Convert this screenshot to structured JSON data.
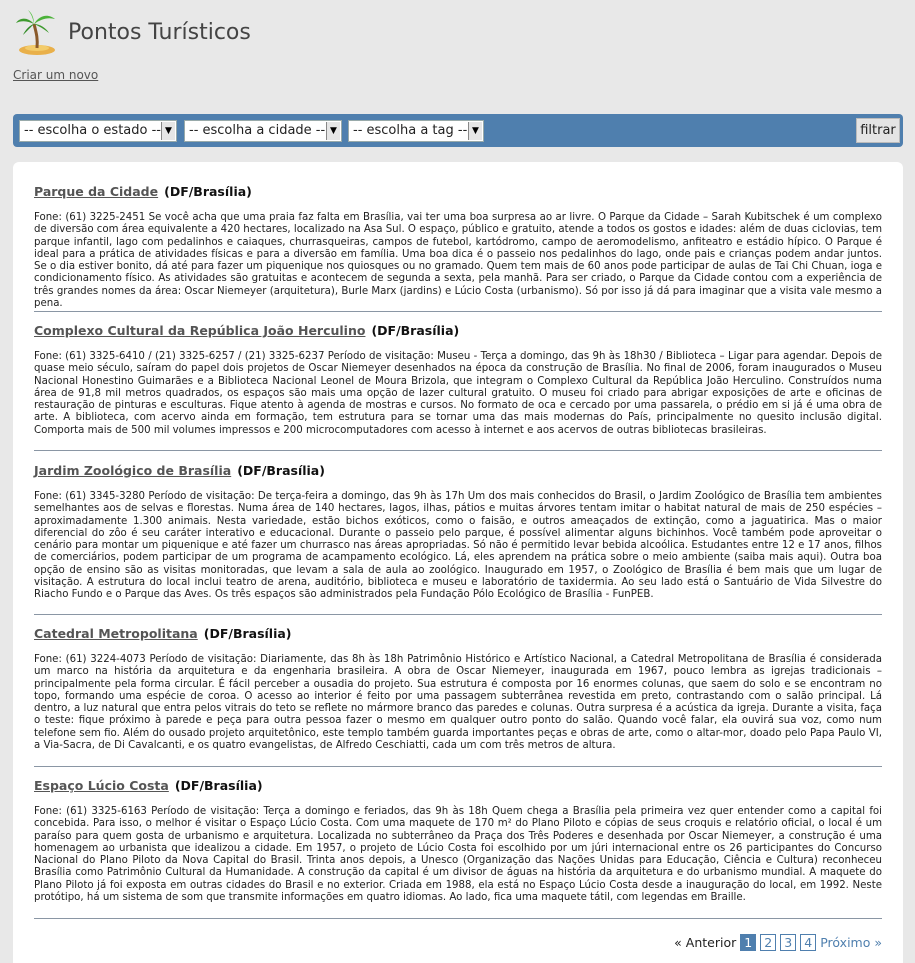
{
  "header": {
    "title": "Pontos Turísticos",
    "create_link": "Criar um novo"
  },
  "filters": {
    "state": "-- escolha o estado --",
    "city": "-- escolha a cidade --",
    "tag": "-- escolha a tag --",
    "button": "filtrar"
  },
  "entries": [
    {
      "name": "Parque da Cidade",
      "location": "(DF/Brasília)",
      "description": "Fone: (61) 3225-2451 Se você acha que uma praia faz falta em Brasília, vai ter uma boa surpresa ao ar livre. O Parque da Cidade – Sarah Kubitschek é um complexo de diversão com área equivalente a 420 hectares, localizado na Asa Sul. O espaço, público e gratuito, atende a todos os gostos e idades: além de duas ciclovias, tem parque infantil, lago com pedalinhos e caiaques, churrasqueiras, campos de futebol, kartódromo, campo de aeromodelismo, anfiteatro e estádio hípico. O Parque é ideal para a prática de atividades físicas e para a diversão em família. Uma boa dica é o passeio nos pedalinhos do lago, onde pais e crianças podem andar juntos. Se o dia estiver bonito, dá até para fazer um piquenique nos quiosques ou no gramado. Quem tem mais de 60 anos pode participar de aulas de Tai Chi Chuan, ioga e condicionamento físico. As atividades são gratuitas e acontecem de segunda a sexta, pela manhã. Para ser criado, o Parque da Cidade contou com a experiência de três grandes nomes da área: Oscar Niemeyer (arquitetura), Burle Marx (jardins) e Lúcio Costa (urbanismo). Só por isso já dá para imaginar que a visita vale mesmo a pena."
    },
    {
      "name": "Complexo Cultural da República João Herculino",
      "location": "(DF/Brasília)",
      "description": "Fone: (61) 3325-6410 / (21) 3325-6257 / (21) 3325-6237 Período de visitação: Museu - Terça a domingo, das 9h às 18h30 / Biblioteca – Ligar para agendar. Depois de quase meio século, saíram do papel dois projetos de Oscar Niemeyer desenhados na época da construção de Brasília. No final de 2006, foram inaugurados o Museu Nacional Honestino Guimarães e a Biblioteca Nacional Leonel de Moura Brizola, que integram o Complexo Cultural da República João Herculino. Construídos numa área de 91,8 mil metros quadrados, os espaços são mais uma opção de lazer cultural gratuito. O museu foi criado para abrigar exposições de arte e oficinas de restauração de pinturas e esculturas. Fique atento à agenda de mostras e cursos. No formato de oca e cercado por uma passarela, o prédio em si já é uma obra de arte. A biblioteca, com acervo ainda em formação, tem estrutura para se tornar uma das mais modernas do País, principalmente no quesito inclusão digital. Comporta mais de 500 mil volumes impressos e 200 microcomputadores com acesso à internet e aos acervos de outras bibliotecas brasileiras."
    },
    {
      "name": "Jardim Zoológico de Brasília",
      "location": "(DF/Brasília)",
      "description": "Fone: (61) 3345-3280 Período de visitação: De terça-feira a domingo, das 9h às 17h Um dos mais conhecidos do Brasil, o Jardim Zoológico de Brasília tem ambientes semelhantes aos de selvas e florestas. Numa área de 140 hectares, lagos, ilhas, pátios e muitas árvores tentam imitar o habitat natural de mais de 250 espécies – aproximadamente 1.300 animais. Nesta variedade, estão bichos exóticos, como o faisão, e outros ameaçados de extinção, como a jaguatirica. Mas o maior diferencial do zôo é seu caráter interativo e educacional. Durante o passeio pelo parque, é possível alimentar alguns bichinhos. Você também pode aproveitar o cenário para montar um piquenique e até fazer um churrasco nas áreas apropriadas. Só não é permitido levar bebida alcoólica. Estudantes entre 12 e 17 anos, filhos de comerciários, podem participar de um programa de acampamento ecológico. Lá, eles aprendem na prática sobre o meio ambiente (saiba mais aqui). Outra boa opção de ensino são as visitas monitoradas, que levam a sala de aula ao zoológico. Inaugurado em 1957, o Zoológico de Brasília é bem mais que um lugar de visitação. A estrutura do local inclui teatro de arena, auditório, biblioteca e museu e laboratório de taxidermia. Ao seu lado está o Santuário de Vida Silvestre do Riacho Fundo e o Parque das Aves. Os três espaços são administrados pela Fundação Pólo Ecológico de Brasília - FunPEB."
    },
    {
      "name": "Catedral Metropolitana",
      "location": "(DF/Brasília)",
      "description": "Fone: (61) 3224-4073 Período de visitação: Diariamente, das 8h às 18h Patrimônio Histórico e Artístico Nacional, a Catedral Metropolitana de Brasília é considerada um marco na história da arquitetura e da engenharia brasileira. A obra de Oscar Niemeyer, inaugurada em 1967, pouco lembra as igrejas tradicionais – principalmente pela forma circular. É fácil perceber a ousadia do projeto. Sua estrutura é composta por 16 enormes colunas, que saem do solo e se encontram no topo, formando uma espécie de coroa. O acesso ao interior é feito por uma passagem subterrânea revestida em preto, contrastando com o salão principal. Lá dentro, a luz natural que entra pelos vitrais do teto se reflete no mármore branco das paredes e colunas. Outra surpresa é a acústica da igreja. Durante a visita, faça o teste: fique próximo à parede e peça para outra pessoa fazer o mesmo em qualquer outro ponto do salão. Quando você falar, ela ouvirá sua voz, como num telefone sem fio. Além do ousado projeto arquitetônico, este templo também guarda importantes peças e obras de arte, como o altar-mor, doado pelo Papa Paulo VI, a Via-Sacra, de Di Cavalcanti, e os quatro evangelistas, de Alfredo Ceschiatti, cada um com três metros de altura."
    },
    {
      "name": "Espaço Lúcio Costa",
      "location": "(DF/Brasília)",
      "description": "Fone: (61) 3325-6163 Período de visitação: Terça a domingo e feriados, das 9h às 18h Quem chega a Brasília pela primeira vez quer entender como a capital foi concebida. Para isso, o melhor é visitar o Espaço Lúcio Costa. Com uma maquete de 170 m² do Plano Piloto e cópias de seus croquis e relatório oficial, o local é um paraíso para quem gosta de urbanismo e arquitetura. Localizada no subterrâneo da Praça dos Três Poderes e desenhada por Oscar Niemeyer, a construção é uma homenagem ao urbanista que idealizou a cidade. Em 1957, o projeto de Lúcio Costa foi escolhido por um júri internacional entre os 26 participantes do Concurso Nacional do Plano Piloto da Nova Capital do Brasil. Trinta anos depois, a Unesco (Organização das Nações Unidas para Educação, Ciência e Cultura) reconheceu Brasília como Patrimônio Cultural da Humanidade. A construção da capital é um divisor de águas na história da arquitetura e do urbanismo mundial. A maquete do Plano Piloto já foi exposta em outras cidades do Brasil e no exterior. Criada em 1988, ela está no Espaço Lúcio Costa desde a inauguração do local, em 1992. Neste protótipo, há um sistema de som que transmite informações em quatro idiomas. Ao lado, fica uma maquete tátil, com legendas em Braille."
    }
  ],
  "pagination": {
    "prev": "« Anterior",
    "pages": [
      "1",
      "2",
      "3",
      "4"
    ],
    "current": "1",
    "next": "Próximo »"
  },
  "colors": {
    "accent": "#4f7fae",
    "background": "#e8e8e8"
  },
  "icons": {
    "logo": "palm-tree-island-icon"
  }
}
